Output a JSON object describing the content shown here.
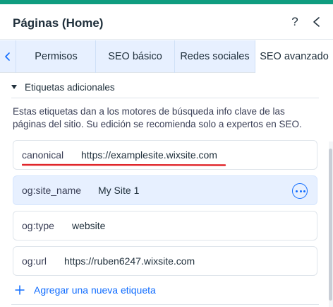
{
  "header": {
    "title": "Páginas (Home)",
    "help_label": "?"
  },
  "tabs": [
    {
      "label": "Permisos"
    },
    {
      "label": "SEO básico"
    },
    {
      "label": "Redes sociales"
    },
    {
      "label": "SEO avanzado",
      "active": true
    }
  ],
  "section": {
    "label": "Etiquetas adicionales",
    "expanded": true,
    "description": "Estas etiquetas dan a los motores de búsqueda info clave de las páginas del sitio. Su edición se recomienda solo a expertos en SEO."
  },
  "tags": [
    {
      "key": "canonical",
      "value": "https://examplesite.wixsite.com"
    },
    {
      "key": "og:site_name",
      "value": "My Site 1"
    },
    {
      "key": "og:type",
      "value": "website"
    },
    {
      "key": "og:url",
      "value": "https://ruben6247.wixsite.com"
    }
  ],
  "add_tag_label": "Agregar una nueva etiqueta",
  "colors": {
    "accent_top": "#0f9d80",
    "primary": "#116dff",
    "tab_bar": "#e7f0ff",
    "annotation": "#e0262b"
  },
  "icons": [
    "close-chevron-icon",
    "scroll-left-chevron-icon",
    "caret-down-icon",
    "more-options-icon",
    "plus-icon"
  ]
}
